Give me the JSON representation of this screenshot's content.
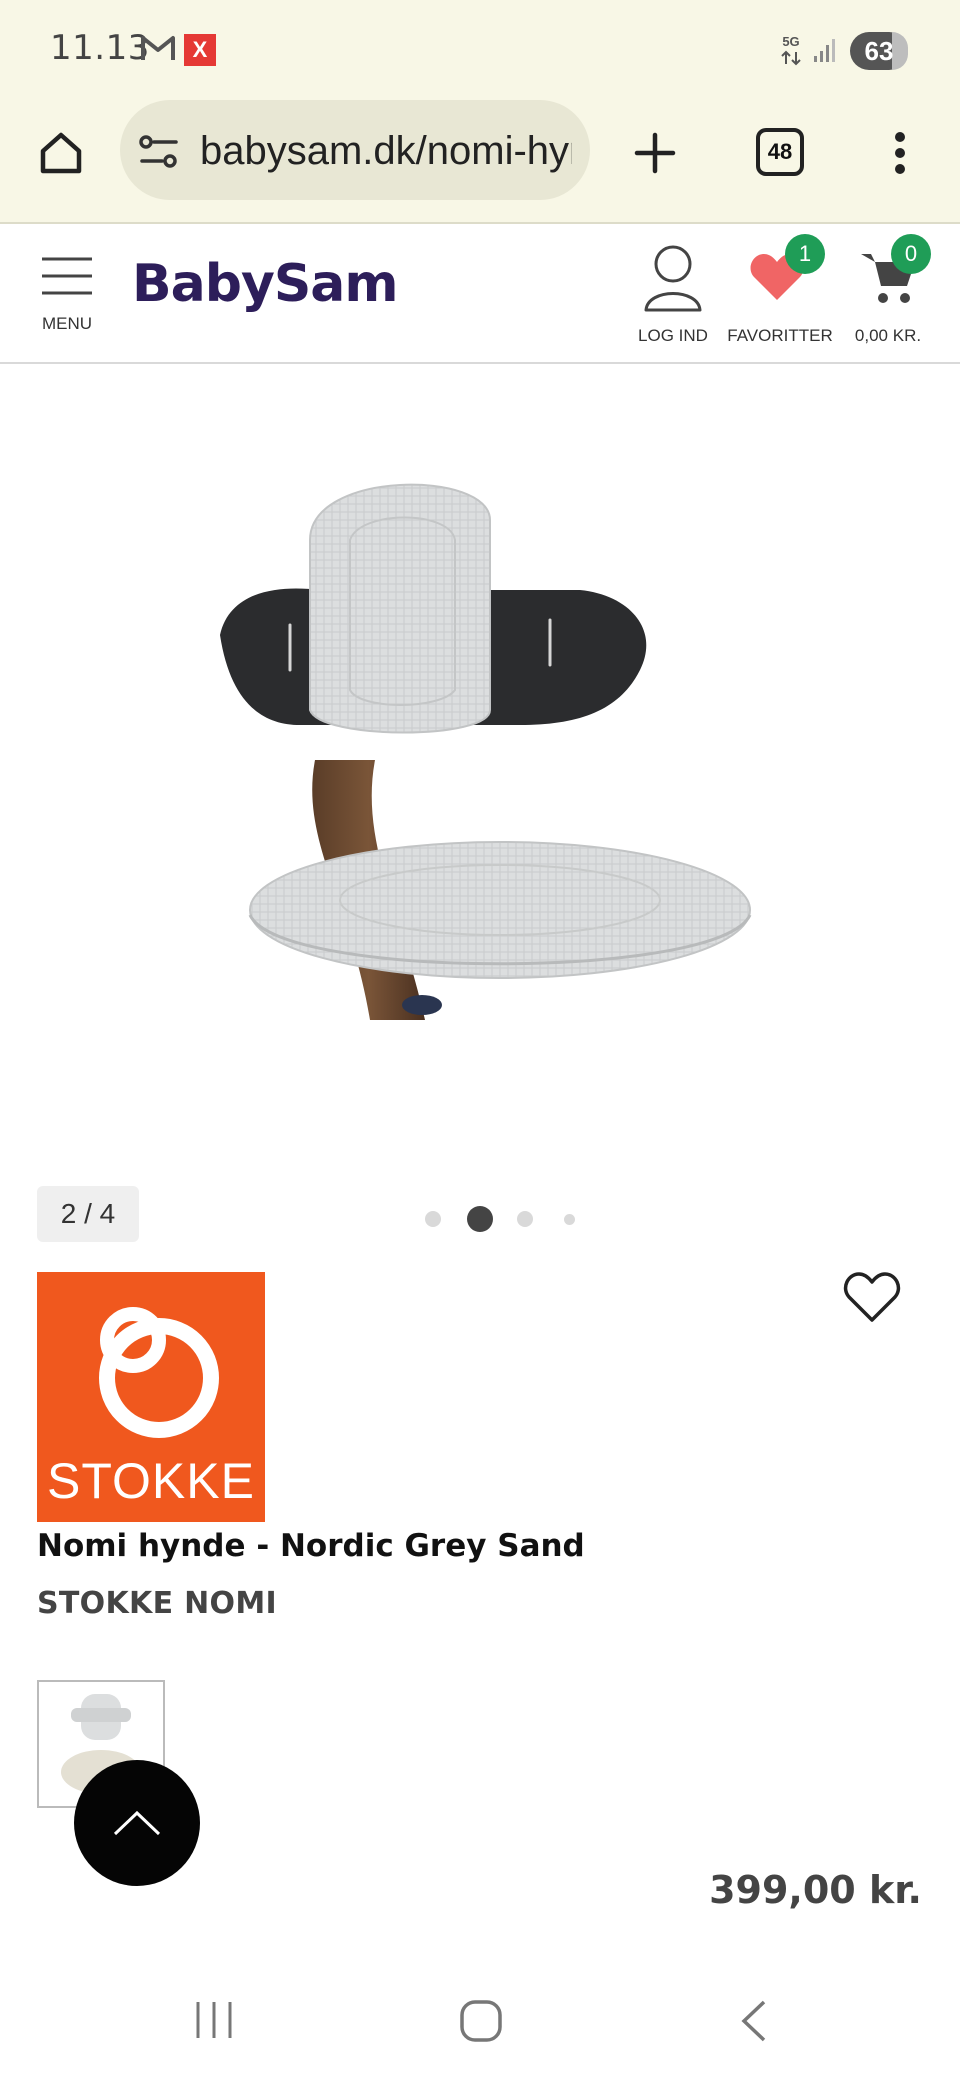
{
  "status_bar": {
    "time": "11.13",
    "notifications": [
      "gmail-icon",
      "x-icon"
    ],
    "x_badge": "X",
    "network": "5G",
    "battery": "63"
  },
  "browser": {
    "url": "babysam.dk/nomi-hynde",
    "tab_count": "48"
  },
  "site_header": {
    "logo": "BabySam",
    "menu_label": "MENU",
    "login_label": "LOG IND",
    "favorites_label": "FAVORITTER",
    "favorites_count": "1",
    "cart_label": "0,00 KR.",
    "cart_count": "0",
    "colors": {
      "brand": "#2d1e5a",
      "badge": "#1f9d57",
      "heart": "#f06565"
    }
  },
  "gallery": {
    "counter": "2 / 4",
    "current_index": 2,
    "total": 4
  },
  "product": {
    "brand_logo_text": "STOKKE",
    "title": "Nomi hynde - Nordic Grey Sand",
    "brand": "STOKKE NOMI",
    "price": "399,00 kr.",
    "brand_color": "#f0581e"
  }
}
